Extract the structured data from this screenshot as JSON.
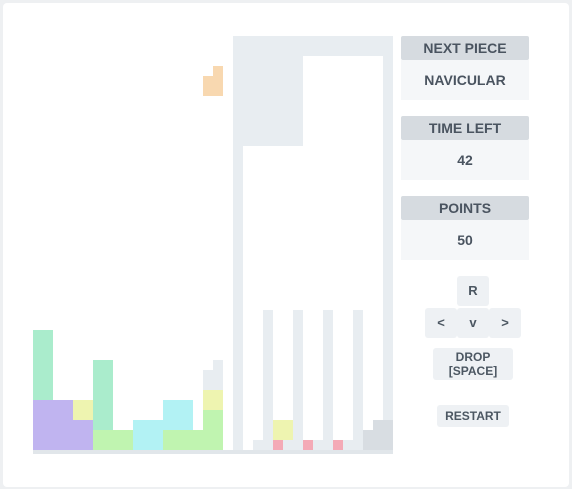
{
  "panels": {
    "next_piece": {
      "label": "NEXT PIECE",
      "value": "NAVICULAR"
    },
    "time_left": {
      "label": "TIME LEFT",
      "value": "42"
    },
    "points": {
      "label": "POINTS",
      "value": "50"
    }
  },
  "controls": {
    "rotate": "R",
    "left": "<",
    "down": "v",
    "right": ">",
    "drop_line1": "DROP",
    "drop_line2": "[SPACE]",
    "restart": "RESTART"
  },
  "colors": {
    "purple": "#c0b4f0",
    "mint": "#aaeccc",
    "light_green": "#c0f4b0",
    "cyan": "#b2f2f4",
    "yellow": "#eef4b0",
    "orange": "#f8d8b0",
    "pink": "#f4aab6",
    "grey_cell": "#e8edf1",
    "slate_cell": "#d8dde2"
  }
}
